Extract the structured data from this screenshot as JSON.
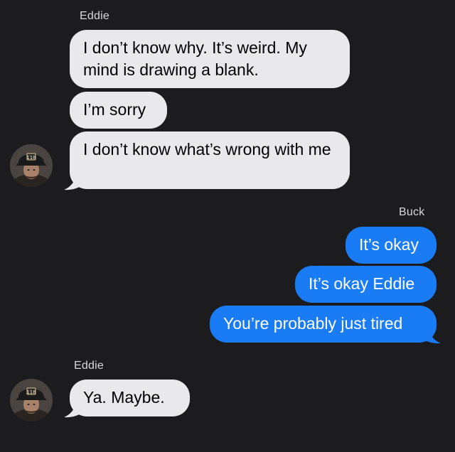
{
  "colors": {
    "background": "#1c1c1e",
    "received_bubble": "#e9e9eb",
    "sent_bubble": "#1a7cf5",
    "sender_label": "#d9d9de"
  },
  "thread": {
    "group1": {
      "sender": "Eddie",
      "messages": [
        "I don’t know why. It’s weird. My mind is drawing a blank.",
        "I’m sorry",
        "I don’t know what’s wrong with me"
      ],
      "avatar_icon": "firefighter-avatar-icon"
    },
    "group2": {
      "sender": "Buck",
      "messages": [
        "It’s okay",
        "It’s okay Eddie",
        "You’re probably just tired"
      ]
    },
    "group3": {
      "sender": "Eddie",
      "messages": [
        "Ya. Maybe."
      ],
      "avatar_icon": "firefighter-avatar-icon"
    }
  }
}
